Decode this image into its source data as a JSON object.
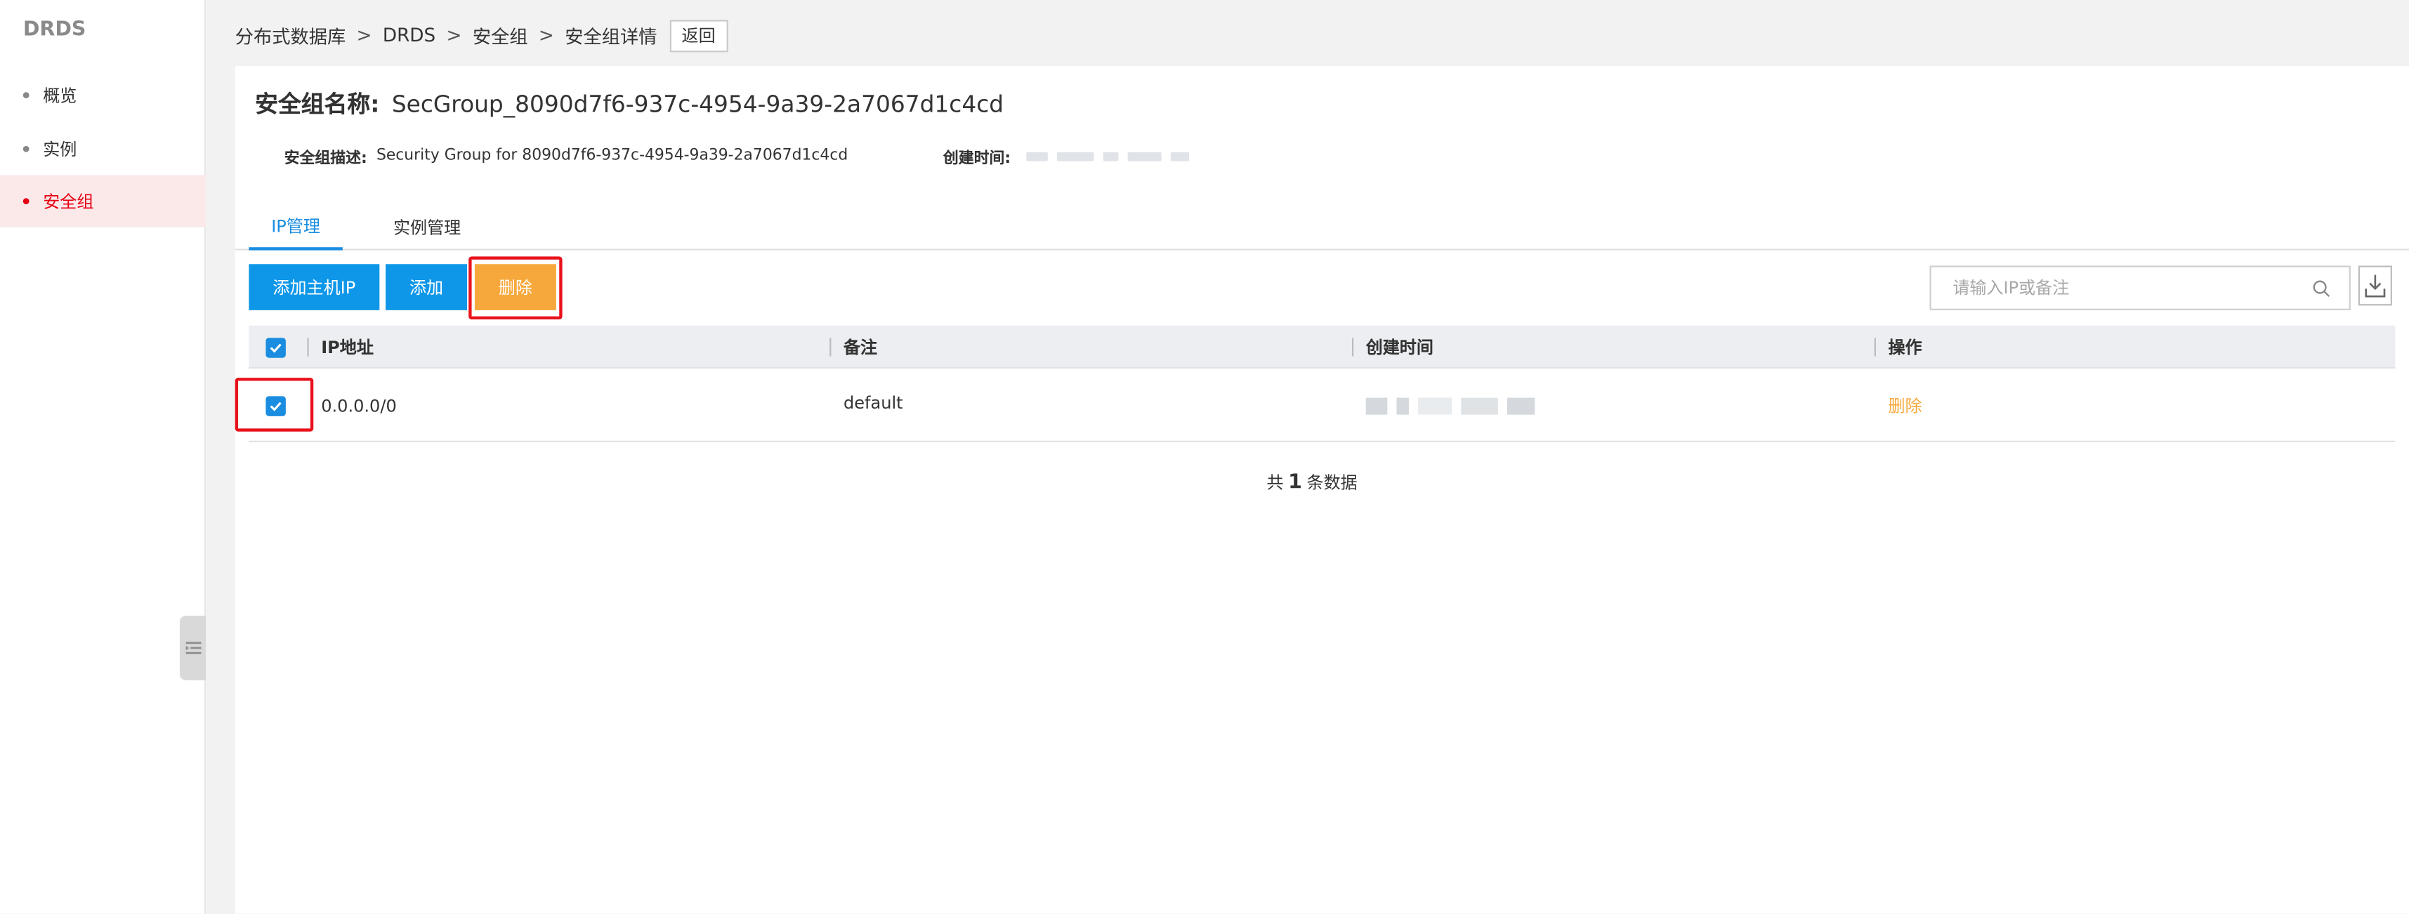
{
  "sidebar": {
    "product": "DRDS",
    "items": [
      {
        "label": "概览",
        "active": false
      },
      {
        "label": "实例",
        "active": false
      },
      {
        "label": "安全组",
        "active": true
      }
    ]
  },
  "breadcrumb": {
    "items": [
      "分布式数据库",
      "DRDS",
      "安全组",
      "安全组详情"
    ],
    "separator": ">",
    "back_label": "返回"
  },
  "detail": {
    "name_label": "安全组名称:",
    "name_value": "SecGroup_8090d7f6-937c-4954-9a39-2a7067d1c4cd",
    "desc_label": "安全组描述:",
    "desc_value": "Security Group for 8090d7f6-937c-4954-9a39-2a7067d1c4cd",
    "created_label": "创建时间:"
  },
  "tabs": [
    {
      "label": "IP管理",
      "active": true
    },
    {
      "label": "实例管理",
      "active": false
    }
  ],
  "toolbar": {
    "add_host_ip_label": "添加主机IP",
    "add_label": "添加",
    "delete_label": "删除",
    "search_placeholder": "请输入IP或备注"
  },
  "table": {
    "columns": [
      "IP地址",
      "备注",
      "创建时间",
      "操作"
    ],
    "rows": [
      {
        "ip": "0.0.0.0/0",
        "remark": "default",
        "action": "删除",
        "checked": true
      }
    ]
  },
  "pager": {
    "prefix": "共",
    "count": "1",
    "suffix": "条数据"
  },
  "colors": {
    "primary": "#0e97e8",
    "warning": "#f7a83c",
    "highlight": "#e8121c",
    "active_nav": "#e60012"
  }
}
